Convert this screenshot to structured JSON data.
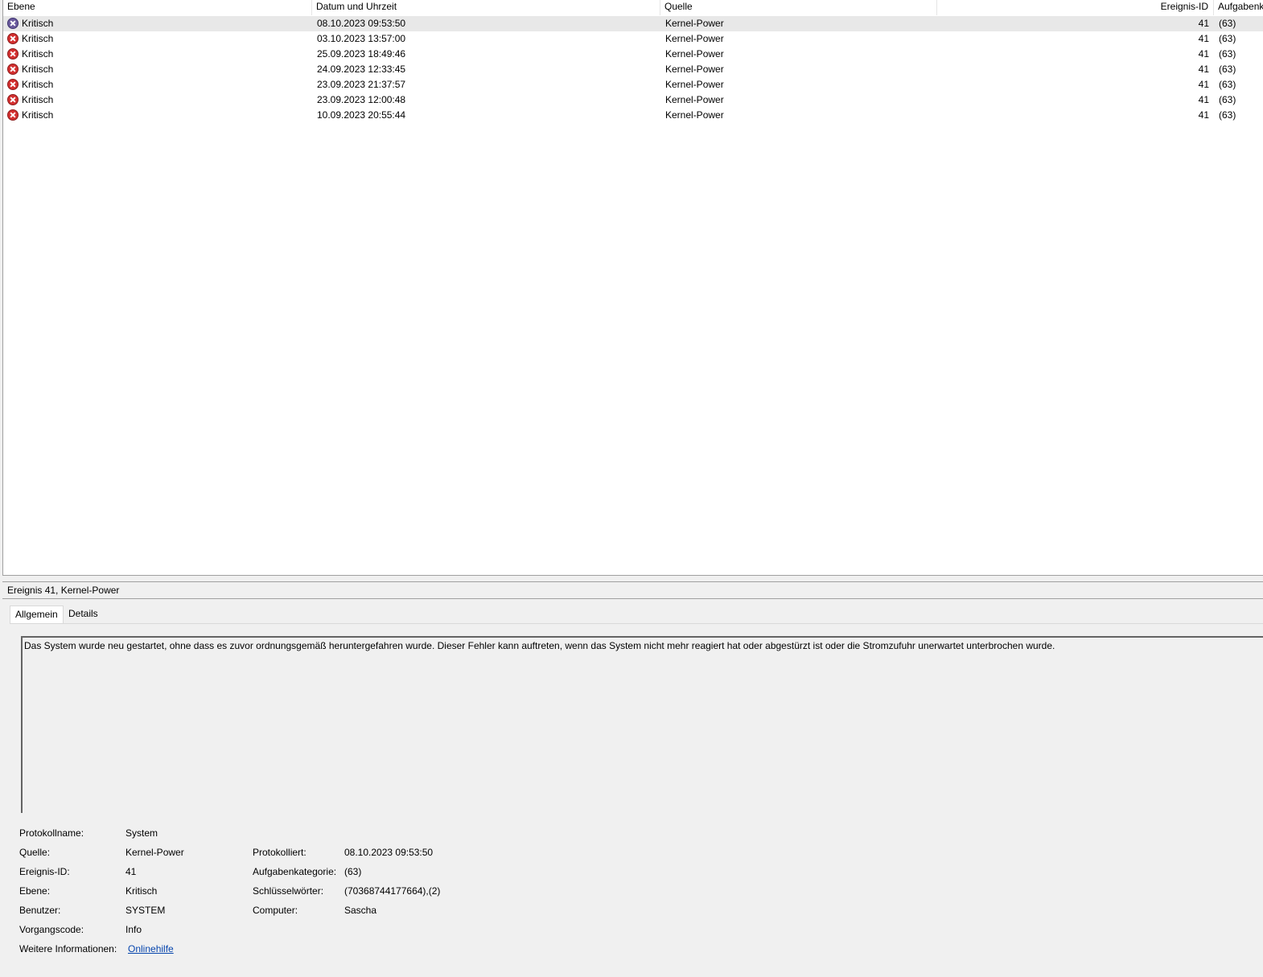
{
  "table": {
    "columns": {
      "level": "Ebene",
      "datetime": "Datum und Uhrzeit",
      "source": "Quelle",
      "event_id": "Ereignis-ID",
      "task_category": "Aufgabenkategorie"
    },
    "rows": [
      {
        "level": "Kritisch",
        "datetime": "08.10.2023 09:53:50",
        "source": "Kernel-Power",
        "event_id": "41",
        "task_category": "(63)",
        "selected": true
      },
      {
        "level": "Kritisch",
        "datetime": "03.10.2023 13:57:00",
        "source": "Kernel-Power",
        "event_id": "41",
        "task_category": "(63)"
      },
      {
        "level": "Kritisch",
        "datetime": "25.09.2023 18:49:46",
        "source": "Kernel-Power",
        "event_id": "41",
        "task_category": "(63)"
      },
      {
        "level": "Kritisch",
        "datetime": "24.09.2023 12:33:45",
        "source": "Kernel-Power",
        "event_id": "41",
        "task_category": "(63)"
      },
      {
        "level": "Kritisch",
        "datetime": "23.09.2023 21:37:57",
        "source": "Kernel-Power",
        "event_id": "41",
        "task_category": "(63)"
      },
      {
        "level": "Kritisch",
        "datetime": "23.09.2023 12:00:48",
        "source": "Kernel-Power",
        "event_id": "41",
        "task_category": "(63)"
      },
      {
        "level": "Kritisch",
        "datetime": "10.09.2023 20:55:44",
        "source": "Kernel-Power",
        "event_id": "41",
        "task_category": "(63)"
      }
    ]
  },
  "detail": {
    "title": "Ereignis 41, Kernel-Power",
    "tabs": {
      "general": "Allgemein",
      "details": "Details"
    },
    "description": "Das System wurde neu gestartet, ohne dass es zuvor ordnungsgemäß heruntergefahren wurde. Dieser Fehler kann auftreten, wenn das System nicht mehr reagiert hat oder abgestürzt ist oder die Stromzufuhr unerwartet unterbrochen wurde.",
    "fields": {
      "log_name_label": "Protokollname:",
      "log_name": "System",
      "source_label": "Quelle:",
      "source": "Kernel-Power",
      "logged_label": "Protokolliert:",
      "logged": "08.10.2023 09:53:50",
      "event_id_label": "Ereignis-ID:",
      "event_id": "41",
      "task_category_label": "Aufgabenkategorie:",
      "task_category": "(63)",
      "level_label": "Ebene:",
      "level": "Kritisch",
      "keywords_label": "Schlüsselwörter:",
      "keywords": "(70368744177664),(2)",
      "user_label": "Benutzer:",
      "user": "SYSTEM",
      "computer_label": "Computer:",
      "computer": "Sascha",
      "opcode_label": "Vorgangscode:",
      "opcode": "Info",
      "more_info_label": "Weitere Informationen:",
      "more_info_link": "Onlinehilfe"
    }
  },
  "colors": {
    "critical_icon": "#d32f2f",
    "selected_row": "#e8e8e8",
    "link": "#0645ad"
  },
  "icons": {
    "level_critical": "critical-error-icon"
  }
}
